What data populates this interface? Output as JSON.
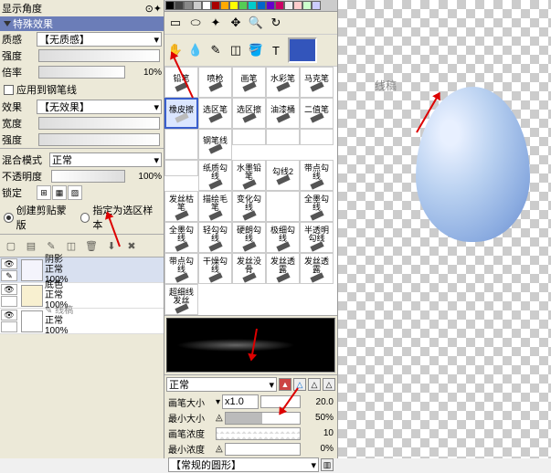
{
  "left": {
    "display_angle_label": "显示角度",
    "section_header": "特殊效果",
    "texture_label": "质感",
    "texture_value": "【无质感】",
    "intensity_label": "强度",
    "ratio_label": "倍率",
    "ratio_value": "10%",
    "apply_brush_cb": "应用到钢笔线",
    "effect_label": "效果",
    "effect_value": "【无效果】",
    "width_label": "宽度",
    "density_label": "强度",
    "blend_mode_label": "混合模式",
    "blend_mode_value": "正常",
    "opacity_label": "不透明度",
    "opacity_value": "100%",
    "lock_label": "锁定",
    "mask_radio1": "创建剪贴蒙版",
    "mask_radio2": "指定为选区样本",
    "layers": [
      {
        "name": "阴影",
        "mode": "正常",
        "opacity": "100%"
      },
      {
        "name": "底色",
        "mode": "正常",
        "opacity": "100%"
      },
      {
        "name": "线稿",
        "mode": "正常",
        "opacity": "100%"
      }
    ]
  },
  "middle": {
    "fg_color": "#3355bb",
    "brushes_r1": [
      "铅笔",
      "喷枪",
      "画笔",
      "水彩笔"
    ],
    "brushes_r2": [
      "马克笔",
      "橡皮擦",
      "选区笔",
      "选区擦"
    ],
    "brushes_r3": [
      "油漆桶",
      "二值笔",
      "",
      "钢笔线"
    ],
    "brushes_r4": [
      "纸质勾线",
      "水墨铅笔",
      "勾线2",
      "带点勾线"
    ],
    "brushes_r5": [
      "发丝枯笔",
      "描绘毛笔",
      "变化勾线",
      ""
    ],
    "brushes_r6": [
      "全墨勾线",
      "全墨勾线",
      "轻勾勾线",
      "硬朗勾线"
    ],
    "brushes_r7": [
      "极细勾线",
      "半透明勾线",
      "带点勾线",
      "干燥勾线"
    ],
    "brushes_r8": [
      "发丝没骨",
      "发丝透露",
      "发丝透露",
      "超细线发丝"
    ],
    "blend_mode": "正常",
    "brush_size_label": "画笔大小",
    "brush_size_mult": "x1.0",
    "brush_size_val": "20.0",
    "min_size_label": "最小大小",
    "min_size_val": "50%",
    "density_label": "画笔浓度",
    "density_val": "10",
    "min_density_label": "最小浓度",
    "min_density_val": "0%",
    "shape_label": "【常规的圆形】"
  },
  "canvas": {
    "label": "线稿"
  }
}
